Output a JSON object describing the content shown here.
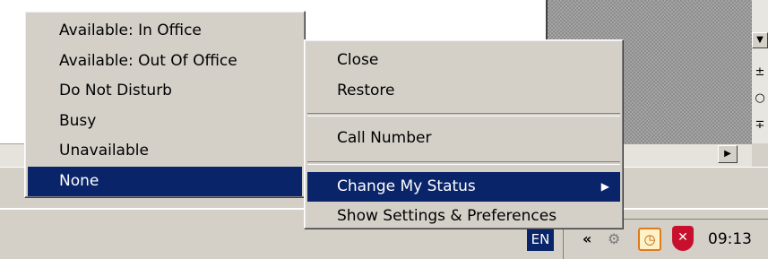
{
  "status_menu": {
    "items": [
      {
        "label": "Available: In Office"
      },
      {
        "label": "Available: Out Of Office"
      },
      {
        "label": "Do Not Disturb"
      },
      {
        "label": "Busy"
      },
      {
        "label": "Unavailable"
      },
      {
        "label": "None",
        "selected": true
      }
    ]
  },
  "context_menu": {
    "close": "Close",
    "restore": "Restore",
    "call_number": "Call Number",
    "change_status": "Change My Status",
    "settings": "Show Settings & Preferences"
  },
  "taskbar": {
    "language": "EN",
    "clock": "09:13"
  },
  "colors": {
    "menu_bg": "#d4d0c8",
    "selection": "#0a246a"
  }
}
